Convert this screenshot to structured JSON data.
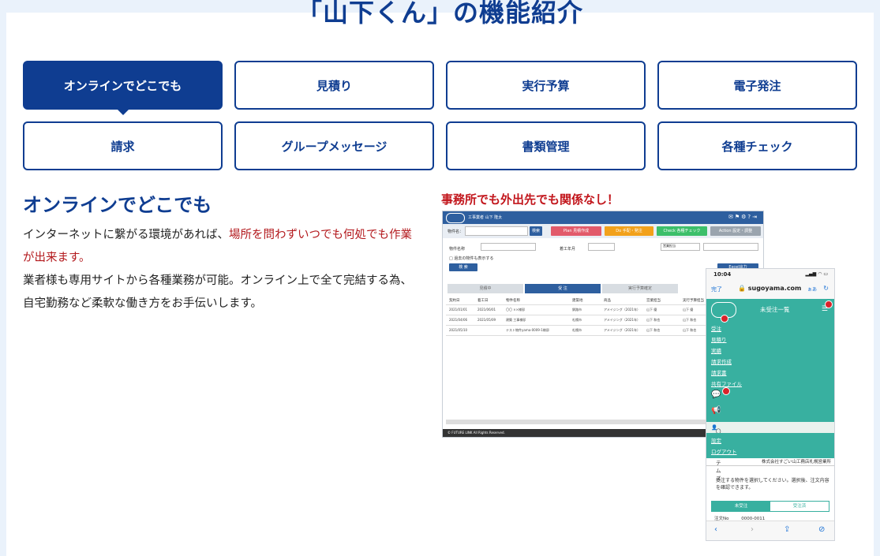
{
  "page_title": "「山下くん」の機能紹介",
  "tabs": [
    {
      "label": "オンラインでどこでも",
      "active": true
    },
    {
      "label": "見積り",
      "active": false
    },
    {
      "label": "実行予算",
      "active": false
    },
    {
      "label": "電子発注",
      "active": false
    },
    {
      "label": "請求",
      "active": false
    },
    {
      "label": "グループメッセージ",
      "active": false
    },
    {
      "label": "書類管理",
      "active": false
    },
    {
      "label": "各種チェック",
      "active": false
    }
  ],
  "section": {
    "title": "オンラインでどこでも",
    "para1_prefix": "インターネットに繋がる環境があれば、",
    "para1_highlight": "場所を問わずいつでも何処でも作業が出来ます。",
    "para2": "業者様も専用サイトから各種業務が可能。オンライン上で全て完結する為、自宅勤務など柔軟な働き方をお手伝いします。"
  },
  "caption": "事務所でも外出先でも関係なし！",
  "desktop": {
    "user": "工事業者 山下 隆太",
    "search_label": "物件名：",
    "search_btn": "検索",
    "plan_btn": "Plan 見積作成",
    "do_btn": "Do 手配・発注",
    "check_btn": "Check 各種チェック",
    "action_btn": "Action 設定・調整",
    "field1": "物件名称",
    "field2": "着工年月",
    "field3": "営業担当",
    "checkbox": "□ 過去の物件も表示する",
    "view_btn": "検 索",
    "excel_btn": "Excel出力",
    "steps": [
      "見積中",
      "受 注",
      "実行予算確定"
    ],
    "headers": [
      "契約日",
      "着工日",
      "物件名称",
      "建築地",
      "商品",
      "営業担当",
      "実行予算担当"
    ],
    "rows": [
      [
        "2021/01/01",
        "2021/06/01",
        "〇〇 ××様邸",
        "釧路市",
        "アメイジング（2021年）",
        "山下 優",
        "山下 優"
      ],
      [
        "2021/04/06",
        "2021/05/09",
        "建築 工事様邸",
        "札幌市",
        "アメイジング（2021年）",
        "山下 和也",
        "山下 和也"
      ],
      [
        "2021/05/10",
        "",
        "テスト物件yama-0009-1様邸",
        "札幌市",
        "アメイジング（2021年）",
        "山下 和也",
        "山下 和也"
      ]
    ],
    "footer": "© FUTURE LINK All Rights Reserved."
  },
  "phone": {
    "time": "10:04",
    "done": "完了",
    "host": "sugoyama.com",
    "aa": "ぁあ",
    "menu_title": "未受注一覧",
    "menu_items": [
      "受注",
      "見積り",
      "実績",
      "請求作成",
      "請求書",
      "共有ファイル"
    ],
    "system": "〇〇システムズ",
    "menu2_items": [
      "設定",
      "ログアウト"
    ],
    "company": "株式会社すごい山工務店札幌営業所",
    "note": "受注する物件を選択してください。選択後、注文内容を確認できます。",
    "seg_a": "未受注",
    "seg_b": "受注済",
    "order_label": "注文No",
    "order_value": "0000-0011"
  }
}
